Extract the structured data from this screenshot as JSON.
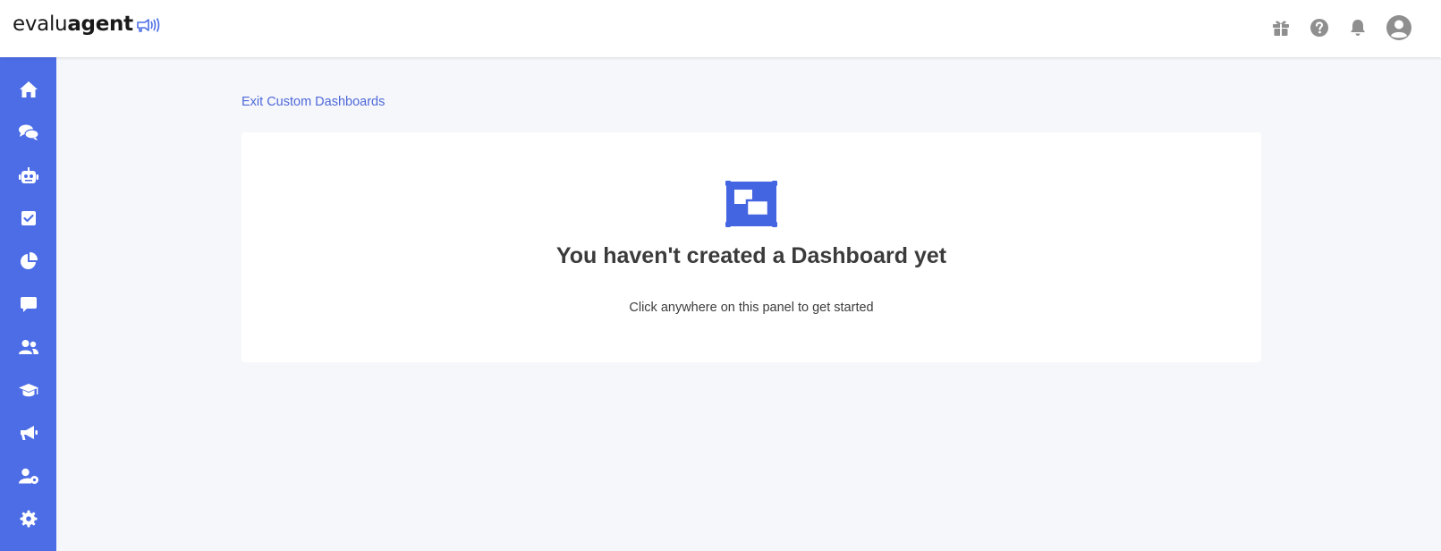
{
  "brand": {
    "logo_light": "evalu",
    "logo_bold": "agent"
  },
  "colors": {
    "accent": "#4c6de6",
    "link": "#4e68d8",
    "icon_gray": "#8f8f8f",
    "background": "#f6f7fb"
  },
  "header": {
    "icons": [
      "gift-icon",
      "help-icon",
      "bell-icon",
      "user-avatar-icon"
    ]
  },
  "sidebar": {
    "items": [
      {
        "icon": "home-icon"
      },
      {
        "icon": "conversations-icon"
      },
      {
        "icon": "robot-icon"
      },
      {
        "icon": "checklist-icon"
      },
      {
        "icon": "pie-chart-icon"
      },
      {
        "icon": "comment-icon"
      },
      {
        "icon": "users-icon"
      },
      {
        "icon": "graduation-cap-icon"
      },
      {
        "icon": "megaphone-icon"
      },
      {
        "icon": "user-settings-icon"
      },
      {
        "icon": "gear-icon"
      }
    ]
  },
  "main": {
    "exit_link": "Exit Custom Dashboards",
    "empty_state": {
      "icon": "dashboard-layout-icon",
      "title": "You haven't created a Dashboard yet",
      "subtitle": "Click anywhere on this panel to get started"
    }
  }
}
